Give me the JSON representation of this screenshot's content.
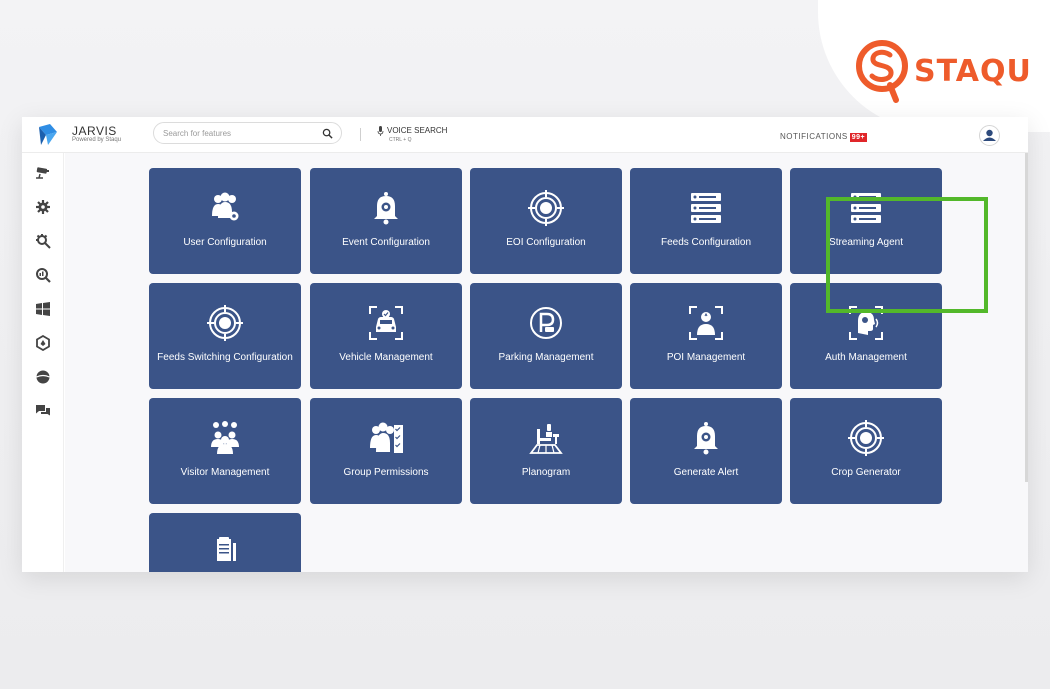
{
  "brand": {
    "name": "STAQU",
    "color": "#ee5b2b"
  },
  "app": {
    "title": "JARVIS",
    "subtitle": "Powered by Staqu",
    "logo_icon": "jarvis-logo-icon"
  },
  "search": {
    "placeholder": "Search for features",
    "icon": "search-icon"
  },
  "voice": {
    "label": "VOICE SEARCH",
    "shortcut": "CTRL + Q",
    "icon": "microphone-icon"
  },
  "notifications": {
    "label": "NOTIFICATIONS",
    "badge": "99+",
    "badge_color": "#e0262a"
  },
  "sidebar": {
    "items": [
      {
        "icon": "cctv-camera-icon"
      },
      {
        "icon": "gear-icon"
      },
      {
        "icon": "gear-search-icon"
      },
      {
        "icon": "magnify-analytics-icon"
      },
      {
        "icon": "windows-icon"
      },
      {
        "icon": "hexagon-shield-icon"
      },
      {
        "icon": "globe-icon"
      },
      {
        "icon": "chat-icon"
      }
    ]
  },
  "tiles": [
    {
      "label": "User Configuration",
      "icon": "users-gear-icon"
    },
    {
      "label": "Event Configuration",
      "icon": "bell-gear-icon"
    },
    {
      "label": "EOI Configuration",
      "icon": "target-icon"
    },
    {
      "label": "Feeds Configuration",
      "icon": "server-list-icon"
    },
    {
      "label": "Streaming Agent",
      "icon": "server-list-icon",
      "highlighted": true
    },
    {
      "label": "Feeds Switching Configuration",
      "icon": "target-icon"
    },
    {
      "label": "Vehicle Management",
      "icon": "car-scan-icon"
    },
    {
      "label": "Parking Management",
      "icon": "parking-icon"
    },
    {
      "label": "POI Management",
      "icon": "person-scan-icon"
    },
    {
      "label": "Auth Management",
      "icon": "face-scan-icon"
    },
    {
      "label": "Visitor Management",
      "icon": "visitor-group-icon"
    },
    {
      "label": "Group Permissions",
      "icon": "group-checklist-icon"
    },
    {
      "label": "Planogram",
      "icon": "shelf-layout-icon"
    },
    {
      "label": "Generate Alert",
      "icon": "bell-gear-icon"
    },
    {
      "label": "Crop Generator",
      "icon": "target-icon"
    },
    {
      "label": "",
      "icon": "document-pen-icon"
    }
  ],
  "colors": {
    "tile": "#3b5488",
    "highlight": "#53b82a"
  }
}
